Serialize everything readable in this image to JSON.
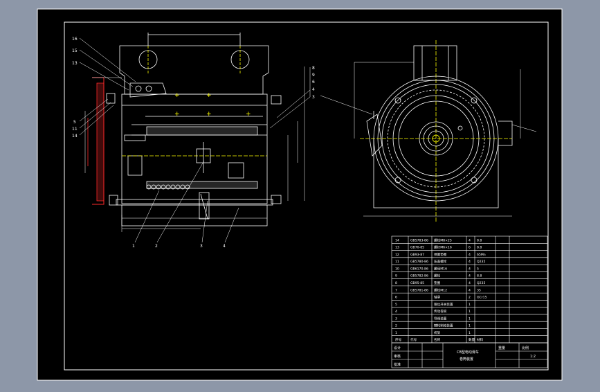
{
  "colors": {
    "background": "#8d97a8",
    "paper": "#000000",
    "line": "#ffffff",
    "accent_red": "#ff2a2a",
    "accent_yellow": "#ffff00",
    "dim_text": "#cfcfcf"
  },
  "side_balloons": [
    "16",
    "15",
    "13",
    "5",
    "11",
    "14"
  ],
  "top_balloons": [
    "8",
    "9",
    "6",
    "4",
    "3"
  ],
  "bottom_balloons": [
    "1",
    "2",
    "3",
    "4"
  ],
  "bom": {
    "rows": [
      {
        "no": "14",
        "code": "GB5783-86",
        "name": "螺栓M8×25",
        "qty": "4",
        "mat": "8.8"
      },
      {
        "no": "13",
        "code": "GB70-85",
        "name": "螺钉M6×16",
        "qty": "6",
        "mat": "8.8"
      },
      {
        "no": "12",
        "code": "GB93-87",
        "name": "弹簧垫圈",
        "qty": "4",
        "mat": "65Mn"
      },
      {
        "no": "11",
        "code": "GB5780-86",
        "name": "压盖螺栓",
        "qty": "4",
        "mat": "Q235"
      },
      {
        "no": "10",
        "code": "GB6170-86",
        "name": "螺母M16",
        "qty": "4",
        "mat": "5"
      },
      {
        "no": "9",
        "code": "GB5782-86",
        "name": "螺栓",
        "qty": "4",
        "mat": "8.8"
      },
      {
        "no": "8",
        "code": "GB95-85",
        "name": "垫圈",
        "qty": "4",
        "mat": "Q235"
      },
      {
        "no": "7",
        "code": "GB5781-86",
        "name": "螺栓M12",
        "qty": "4",
        "mat": "35"
      },
      {
        "no": "6",
        "code": "",
        "name": "轴承",
        "qty": "2",
        "mat": "GCr15"
      },
      {
        "no": "5",
        "code": "",
        "name": "限位开关装置",
        "qty": "1",
        "mat": ""
      },
      {
        "no": "4",
        "code": "",
        "name": "传动卷筒",
        "qty": "1",
        "mat": ""
      },
      {
        "no": "3",
        "code": "",
        "name": "导绳装置",
        "qty": "1",
        "mat": ""
      },
      {
        "no": "2",
        "code": "",
        "name": "棘轮制动装置",
        "qty": "1",
        "mat": ""
      },
      {
        "no": "1",
        "code": "",
        "name": "机架",
        "qty": "1",
        "mat": ""
      }
    ],
    "header": {
      "no": "序号",
      "code": "代号",
      "name": "名称",
      "qty": "数量",
      "mat": "材料"
    }
  },
  "title_block": {
    "title_line1": "CB型电动滑车",
    "title_line2": "卷筒装置",
    "scale": "1:2",
    "drawn_label": "设计",
    "checked_label": "审核",
    "approved_label": "批准",
    "weight_label": "重量",
    "scale_label": "比例"
  }
}
